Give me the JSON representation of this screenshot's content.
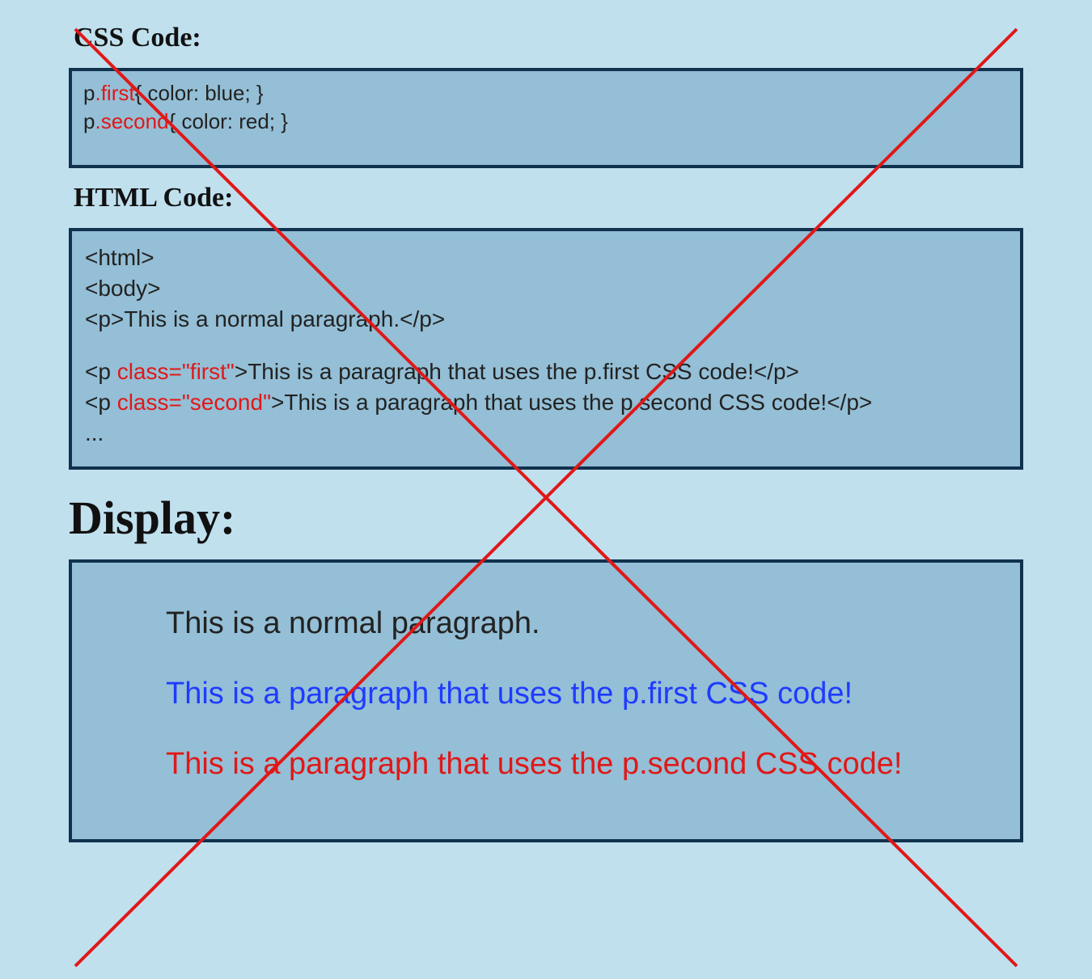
{
  "sections": {
    "css_heading": "CSS Code:",
    "html_heading": "HTML Code:",
    "display_heading": "Display:"
  },
  "css_box": {
    "line1": {
      "pre": "p",
      "highlight": ".first",
      "post": "{ color: blue; }"
    },
    "line2": {
      "pre": "p",
      "highlight": ".second",
      "post": "{ color: red; }"
    }
  },
  "html_box": {
    "l1": "<html>",
    "l2": "<body>",
    "l3": "<p>This is a normal paragraph.</p>",
    "gap": "",
    "l4": {
      "pre": "<p ",
      "highlight": "class=\"first\"",
      "post": ">This is a paragraph that uses the p.first CSS code!</p>"
    },
    "l5": {
      "pre": "<p ",
      "highlight": "class=\"second\"",
      "post": ">This is a paragraph that uses the p.second CSS code!</p>"
    },
    "l6": "..."
  },
  "display_box": {
    "p1": "This is a normal paragraph.",
    "p2": "This is a paragraph that uses the p.first CSS code!",
    "p3": "This is a paragraph that uses the p.second CSS code!"
  },
  "overlay": {
    "type": "cross-out",
    "color": "#e01818"
  }
}
